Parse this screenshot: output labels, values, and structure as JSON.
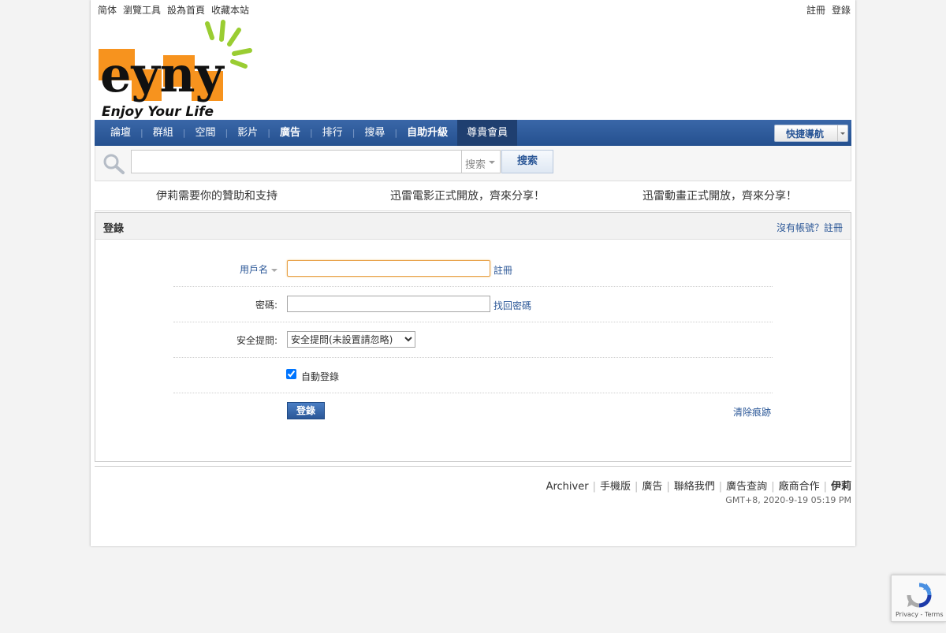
{
  "topbar": {
    "left_links": [
      "简体",
      "瀏覽工具",
      "設為首頁",
      "收藏本站"
    ],
    "right_links": [
      "註冊",
      "登錄"
    ]
  },
  "logo": {
    "text": "eyny",
    "slogan": "Enjoy Your Life",
    "colors": {
      "orange": "#f7931e",
      "accent": "#9acd32",
      "ink": "#111111"
    }
  },
  "nav": {
    "items": [
      "論壇",
      "群組",
      "空間",
      "影片",
      "廣告",
      "排行",
      "搜尋",
      "自助升級",
      "尊貴會員"
    ],
    "quicknav_label": "快捷導航",
    "color": "#2b5797"
  },
  "search": {
    "scope_label": "搜索",
    "button_label": "搜索"
  },
  "announcements": [
    "伊莉需要你的贊助和支持",
    "迅雷電影正式開放，齊來分享！",
    "迅雷動畫正式開放，齊來分享！"
  ],
  "login": {
    "title": "登錄",
    "register_prompt": "沒有帳號？註冊",
    "username_label": "用戶名",
    "username_aside": "註冊",
    "password_label": "密碼:",
    "password_aside": "找回密碼",
    "question_label": "安全提問:",
    "question_option": "安全提問(未設置請忽略)",
    "auto_login_label": "自動登錄",
    "auto_login_checked": true,
    "submit_label": "登錄",
    "clear_label": "清除痕跡"
  },
  "footer": {
    "links": [
      "Archiver",
      "手機版",
      "廣告",
      "聯絡我們",
      "廣告查詢",
      "廠商合作",
      "伊莉"
    ],
    "time": "GMT+8, 2020-9-19 05:19 PM"
  },
  "recaptcha": {
    "terms": "Privacy - Terms"
  }
}
